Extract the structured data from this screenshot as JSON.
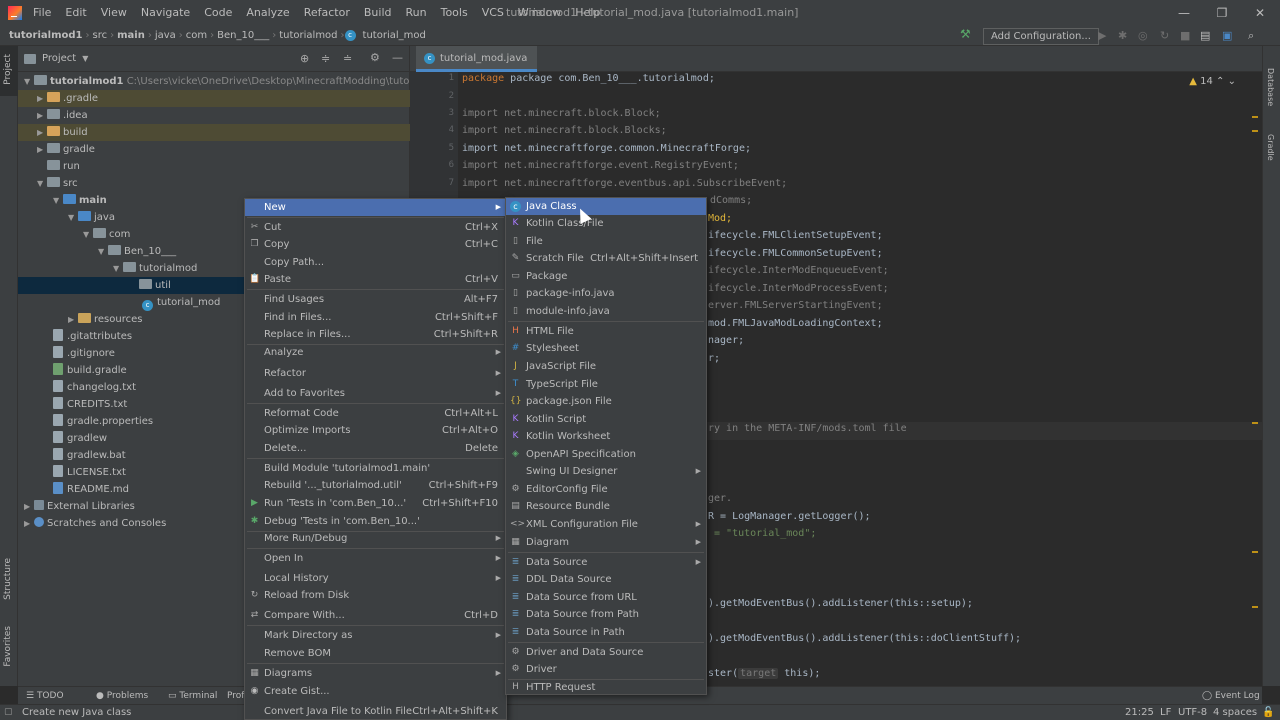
{
  "menubar": {
    "items": [
      "File",
      "Edit",
      "View",
      "Navigate",
      "Code",
      "Analyze",
      "Refactor",
      "Build",
      "Run",
      "Tools",
      "VCS",
      "Window",
      "Help"
    ],
    "title": "tutorialmod1 - tutorial_mod.java [tutorialmod1.main]"
  },
  "navbar": {
    "crumbs": [
      "tutorialmod1",
      "src",
      "main",
      "java",
      "com",
      "Ben_10___",
      "tutorialmod",
      "tutorial_mod"
    ],
    "add_config": "Add Configuration..."
  },
  "project": {
    "header": "Project",
    "root_label": "tutorialmod1",
    "root_path": "C:\\Users\\vicke\\OneDrive\\Desktop\\MinecraftModding\\tutorialmod",
    "tree": [
      ".gradle",
      ".idea",
      "build",
      "gradle",
      "run",
      "src",
      "main",
      "java",
      "com",
      "Ben_10___",
      "tutorialmod",
      "util",
      "tutorial_mod",
      "resources",
      ".gitattributes",
      ".gitignore",
      "build.gradle",
      "changelog.txt",
      "CREDITS.txt",
      "gradle.properties",
      "gradlew",
      "gradlew.bat",
      "LICENSE.txt",
      "README.md",
      "External Libraries",
      "Scratches and Consoles"
    ]
  },
  "editor": {
    "tab": "tutorial_mod.java",
    "warnings": "14",
    "lines": {
      "l1": "package com.Ben_10___.tutorialmod;",
      "l3": "import net.minecraft.block.Block;",
      "l4": "import net.minecraft.block.Blocks;",
      "l5": "import net.minecraftforge.common.MinecraftForge;",
      "l6": "import net.minecraftforge.event.RegistryEvent;",
      "l7": "import net.minecraftforge.eventbus.api.SubscribeEvent;",
      "v1": "dComms;",
      "v2": "Mod;",
      "v3": "ifecycle.FMLClientSetupEvent;",
      "v4": "ifecycle.FMLCommonSetupEvent;",
      "v5": "ifecycle.InterModEnqueueEvent;",
      "v6": "ifecycle.InterModProcessEvent;",
      "v7": "erver.FMLServerStartingEvent;",
      "v8": "mod.FMLJavaModLoadingContext;",
      "v9": "nager;",
      "v10": "r;",
      "v11": "ry in the META-INF/mods.toml file",
      "v12": "ger.",
      "v13": "R = LogManager.getLogger();",
      "v14": " = \"tutorial_mod\";",
      "v15": ").getModEventBus().addListener(this::setup);",
      "v16": ").getModEventBus().addListener(this::doClientStuff);",
      "v17a": "ster(",
      "v17hint": "target",
      "v17b": "this);"
    }
  },
  "context_menu": [
    {
      "label": "New",
      "sub": true,
      "sel": true
    },
    {
      "label": "Cut",
      "sc": "Ctrl+X",
      "icon": "cut-icon"
    },
    {
      "label": "Copy",
      "sc": "Ctrl+C",
      "icon": "copy-icon"
    },
    {
      "label": "Copy Path...",
      "sc": ""
    },
    {
      "label": "Paste",
      "sc": "Ctrl+V",
      "icon": "paste-icon"
    },
    {
      "label": "Find Usages",
      "sc": "Alt+F7"
    },
    {
      "label": "Find in Files...",
      "sc": "Ctrl+Shift+F"
    },
    {
      "label": "Replace in Files...",
      "sc": "Ctrl+Shift+R"
    },
    {
      "label": "Analyze",
      "sub": true
    },
    {
      "label": "Refactor",
      "sub": true
    },
    {
      "label": "Add to Favorites",
      "sub": true
    },
    {
      "label": "Reformat Code",
      "sc": "Ctrl+Alt+L"
    },
    {
      "label": "Optimize Imports",
      "sc": "Ctrl+Alt+O"
    },
    {
      "label": "Delete...",
      "sc": "Delete"
    },
    {
      "label": "Build Module 'tutorialmod1.main'"
    },
    {
      "label": "Rebuild '..._tutorialmod.util'",
      "sc": "Ctrl+Shift+F9"
    },
    {
      "label": "Run 'Tests in 'com.Ben_10...'",
      "sc": "Ctrl+Shift+F10",
      "icon": "run-icon"
    },
    {
      "label": "Debug 'Tests in 'com.Ben_10...'",
      "icon": "debug-icon"
    },
    {
      "label": "More Run/Debug",
      "sub": true
    },
    {
      "label": "Open In",
      "sub": true
    },
    {
      "label": "Local History",
      "sub": true
    },
    {
      "label": "Reload from Disk",
      "icon": "reload-icon"
    },
    {
      "label": "Compare With...",
      "sc": "Ctrl+D",
      "icon": "compare-icon"
    },
    {
      "label": "Mark Directory as",
      "sub": true
    },
    {
      "label": "Remove BOM"
    },
    {
      "label": "Diagrams",
      "sub": true,
      "icon": "diagram-icon"
    },
    {
      "label": "Create Gist...",
      "icon": "github-icon"
    },
    {
      "label": "Convert Java File to Kotlin File",
      "sc": "Ctrl+Alt+Shift+K"
    }
  ],
  "submenu": [
    {
      "label": "Java Class",
      "sel": true,
      "icon": "java-class-icon"
    },
    {
      "label": "Kotlin Class/File",
      "icon": "kotlin-icon"
    },
    {
      "label": "File",
      "icon": "file-icon"
    },
    {
      "label": "Scratch File",
      "sc": "Ctrl+Alt+Shift+Insert",
      "icon": "scratch-file-icon"
    },
    {
      "label": "Package",
      "icon": "package-icon"
    },
    {
      "label": "package-info.java",
      "icon": "java-file-icon"
    },
    {
      "label": "module-info.java",
      "icon": "java-file-icon"
    },
    {
      "label": "HTML File",
      "icon": "html-icon"
    },
    {
      "label": "Stylesheet",
      "icon": "css-icon"
    },
    {
      "label": "JavaScript File",
      "icon": "js-icon"
    },
    {
      "label": "TypeScript File",
      "icon": "ts-icon"
    },
    {
      "label": "package.json File",
      "icon": "json-icon"
    },
    {
      "label": "Kotlin Script",
      "icon": "kotlin-icon"
    },
    {
      "label": "Kotlin Worksheet",
      "icon": "kotlin-icon"
    },
    {
      "label": "OpenAPI Specification",
      "icon": "openapi-icon"
    },
    {
      "label": "Swing UI Designer",
      "sub": true
    },
    {
      "label": "EditorConfig File",
      "icon": "editorconfig-icon"
    },
    {
      "label": "Resource Bundle",
      "icon": "bundle-icon"
    },
    {
      "label": "XML Configuration File",
      "sub": true,
      "icon": "xml-icon"
    },
    {
      "label": "Diagram",
      "sub": true,
      "icon": "diagram-icon"
    },
    {
      "label": "Data Source",
      "sub": true,
      "icon": "database-icon"
    },
    {
      "label": "DDL Data Source",
      "icon": "database-icon"
    },
    {
      "label": "Data Source from URL",
      "icon": "database-icon"
    },
    {
      "label": "Data Source from Path",
      "icon": "database-icon"
    },
    {
      "label": "Data Source in Path",
      "icon": "database-icon"
    },
    {
      "label": "Driver and Data Source",
      "icon": "driver-icon"
    },
    {
      "label": "Driver",
      "icon": "driver-icon"
    },
    {
      "label": "HTTP Request",
      "icon": "http-icon"
    }
  ],
  "bottom_tabs": [
    "TODO",
    "Problems",
    "Terminal",
    "Prof"
  ],
  "event_log": "Event Log",
  "status": {
    "message": "Create new Java class",
    "position": "21:25",
    "line_sep": "LF",
    "encoding": "UTF-8",
    "indent": "4 spaces"
  },
  "side_tabs": {
    "project": "Project",
    "structure": "Structure",
    "favorites": "Favorites",
    "database": "Database",
    "gradle": "Gradle"
  }
}
